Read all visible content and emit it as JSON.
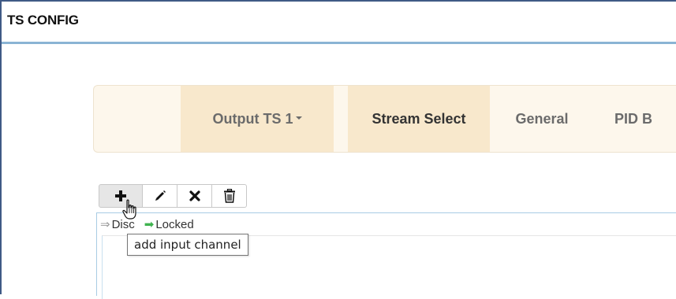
{
  "window": {
    "title": "TS CONFIG"
  },
  "nav": {
    "tabs": [
      {
        "label": "Output TS 1",
        "has_caret": true,
        "active": true
      },
      {
        "label": "Stream Select",
        "active": true
      },
      {
        "label": "General",
        "active": false
      },
      {
        "label": "PID B",
        "active": false
      }
    ]
  },
  "toolbar": {
    "buttons": [
      {
        "name": "add",
        "icon": "plus-icon"
      },
      {
        "name": "edit",
        "icon": "pencil-icon"
      },
      {
        "name": "remove",
        "icon": "x-icon"
      },
      {
        "name": "delete",
        "icon": "trash-icon"
      }
    ]
  },
  "legend": {
    "item1": "Disc",
    "item2": "Locked"
  },
  "tooltip": {
    "text": "add input channel"
  },
  "colors": {
    "accent_border": "#8ab4d4",
    "nav_background": "#fdf7ec",
    "nav_active": "#f8e8cc",
    "locked_arrow": "#3fb34f"
  }
}
